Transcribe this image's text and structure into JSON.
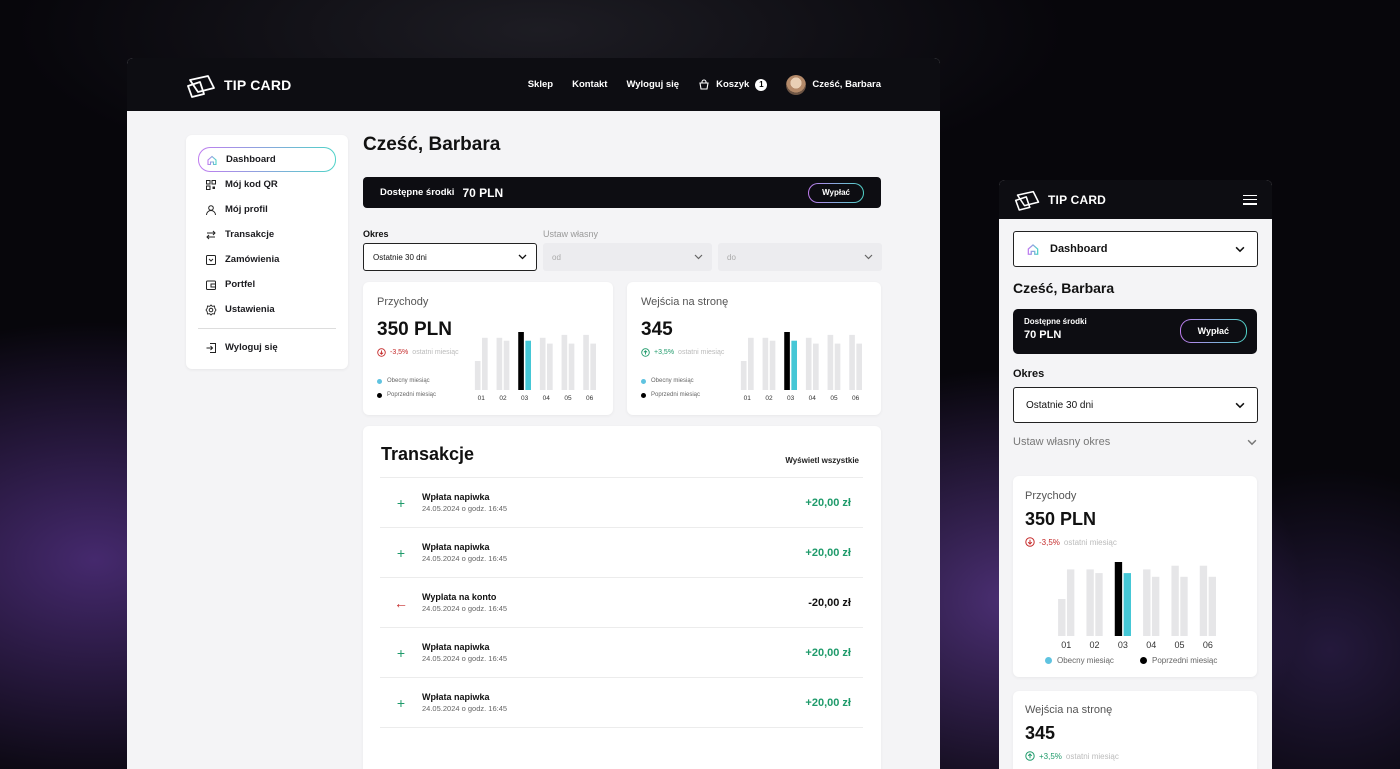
{
  "brand": {
    "name": "TIP CARD"
  },
  "colors": {
    "accent_teal": "#45c7d6",
    "accent_purple": "#c07cf0",
    "positive": "#1e9a6a",
    "negative": "#c52a2a",
    "dark": "#0d0d12"
  },
  "desktop": {
    "nav": {
      "links": [
        "Sklep",
        "Kontakt",
        "Wyloguj się"
      ],
      "cart_label": "Koszyk",
      "cart_count": "1",
      "greeting": "Cześć, Barbara"
    },
    "sidebar": {
      "items": [
        {
          "label": "Dashboard",
          "icon": "home-icon"
        },
        {
          "label": "Mój kod QR",
          "icon": "qr-icon"
        },
        {
          "label": "Mój profil",
          "icon": "user-icon"
        },
        {
          "label": "Transakcje",
          "icon": "transfer-icon"
        },
        {
          "label": "Zamówienia",
          "icon": "orders-icon"
        },
        {
          "label": "Portfel",
          "icon": "wallet-icon"
        },
        {
          "label": "Ustawienia",
          "icon": "gear-icon"
        }
      ],
      "logout": "Wyloguj się"
    },
    "title": "Cześć, Barbara",
    "funds": {
      "label": "Dostępne środki",
      "amount": "70 PLN",
      "button": "Wypłać"
    },
    "filters": {
      "period_label": "Okres",
      "period_value": "Ostatnie 30 dni",
      "custom_label": "Ustaw własny",
      "from_placeholder": "od",
      "to_placeholder": "do"
    },
    "stats": [
      {
        "title": "Przychody",
        "value": "350 PLN",
        "change": "-3,5%",
        "direction": "down",
        "note": "ostatni miesiąc"
      },
      {
        "title": "Wejścia na stronę",
        "value": "345",
        "change": "+3,5%",
        "direction": "up",
        "note": "ostatni miesiąc"
      }
    ],
    "legend": {
      "current": "Obecny miesiąc",
      "previous": "Poprzedni miesiąc"
    },
    "transactions": {
      "title": "Transakcje",
      "view_all": "Wyświetl wszystkie",
      "rows": [
        {
          "name": "Wpłata napiwka",
          "date": "24.05.2024 o godz. 16:45",
          "amount": "+20,00 zł",
          "type": "in"
        },
        {
          "name": "Wpłata napiwka",
          "date": "24.05.2024 o godz. 16:45",
          "amount": "+20,00 zł",
          "type": "in"
        },
        {
          "name": "Wyplata na konto",
          "date": "24.05.2024 o godz. 16:45",
          "amount": "-20,00 zł",
          "type": "out"
        },
        {
          "name": "Wpłata napiwka",
          "date": "24.05.2024 o godz. 16:45",
          "amount": "+20,00 zł",
          "type": "in"
        },
        {
          "name": "Wpłata napiwka",
          "date": "24.05.2024 o godz. 16:45",
          "amount": "+20,00 zł",
          "type": "in"
        }
      ]
    }
  },
  "mobile": {
    "menu_select": "Dashboard",
    "title": "Cześć, Barbara",
    "funds": {
      "label": "Dostępne środki",
      "amount": "70 PLN",
      "button": "Wypłać"
    },
    "period_label": "Okres",
    "period_value": "Ostatnie 30 dni",
    "custom_period": "Ustaw własny okres",
    "stats": [
      {
        "title": "Przychody",
        "value": "350 PLN",
        "change": "-3,5%",
        "direction": "down",
        "note": "ostatni miesiąc"
      },
      {
        "title": "Wejścia na stronę",
        "value": "345",
        "change": "+3,5%",
        "direction": "up",
        "note": "ostatni miesiąc"
      }
    ],
    "legend": {
      "current": "Obecny miesiąc",
      "previous": "Poprzedni miesiąc"
    }
  },
  "chart_data": {
    "type": "bar",
    "categories": [
      "01",
      "02",
      "03",
      "04",
      "05",
      "06"
    ],
    "series": [
      {
        "values": [
          0.5,
          0.9,
          1.0,
          0.9,
          0.95,
          0.95
        ]
      },
      {
        "values": [
          0.9,
          0.85,
          0.85,
          0.8,
          0.8,
          0.8
        ]
      }
    ],
    "highlight_category": "03",
    "highlight_colors": [
      "#000000",
      "#45c7d6"
    ],
    "ylim": [
      0,
      1
    ]
  }
}
